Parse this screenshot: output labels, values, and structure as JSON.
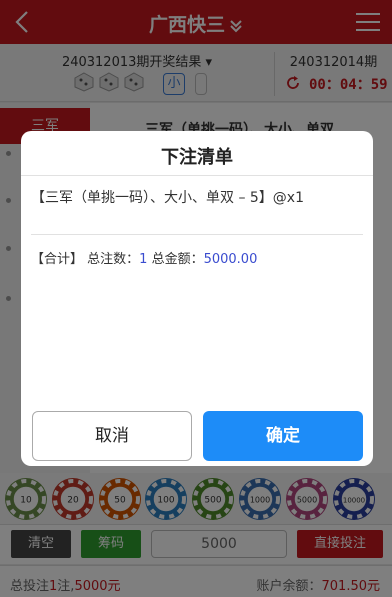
{
  "header": {
    "title": "广西快三"
  },
  "draw": {
    "prev_label": "240312013期开奖结果",
    "size_badge": "小",
    "next_label": "240312014期",
    "countdown": "00：04：59"
  },
  "sidebar": {
    "active_item": "三军"
  },
  "play": {
    "title": "三军（单挑一码）、大小、单双"
  },
  "chips": [
    {
      "value": "10",
      "color": "#6b8f4a"
    },
    {
      "value": "20",
      "color": "#c0392b"
    },
    {
      "value": "50",
      "color": "#d35400"
    },
    {
      "value": "100",
      "color": "#2c7fbf"
    },
    {
      "value": "500",
      "color": "#4f8a2a"
    },
    {
      "value": "1000",
      "color": "#3a6fb0"
    },
    {
      "value": "5000",
      "color": "#b0477f"
    },
    {
      "value": "10000",
      "color": "#2a3f9e"
    }
  ],
  "actions": {
    "clear_label": "清空",
    "chip_label": "筹码",
    "amount_value": "5000",
    "bet_label": "直接投注"
  },
  "footer": {
    "total_prefix": "总投注",
    "total_count": "1",
    "total_mid": "注,",
    "total_amount": "5000元",
    "balance_label": "账户余额：",
    "balance_value": "701.50元"
  },
  "modal": {
    "title": "下注清单",
    "item_text": "【三军（单挑一码）、大小、单双 – 5】@x1",
    "sum_label": "【合计】 总注数：",
    "sum_count": "1",
    "sum_amount_label": "总金额：",
    "sum_amount": "5000.00",
    "cancel_label": "取消",
    "ok_label": "确定"
  }
}
